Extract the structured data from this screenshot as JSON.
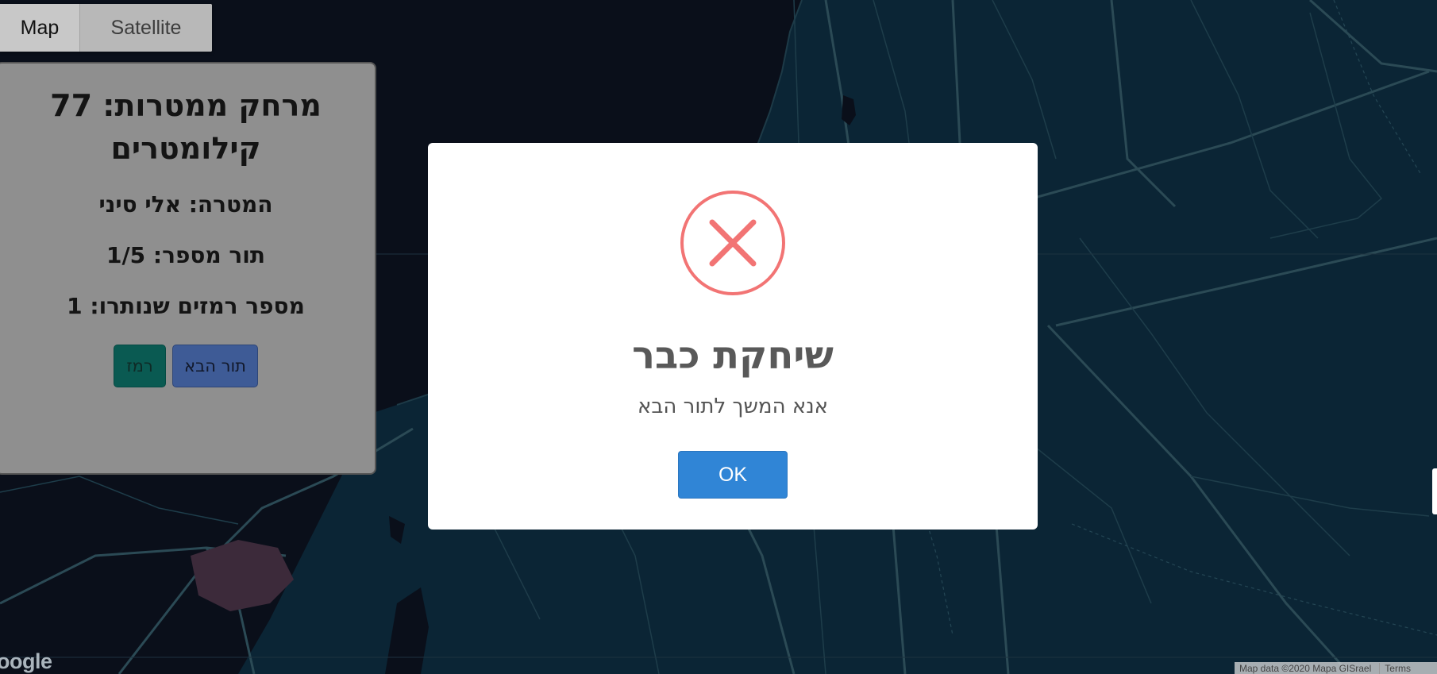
{
  "map": {
    "type_control": {
      "map_label": "Map",
      "satellite_label": "Satellite"
    },
    "google_logo_text": "oogle",
    "attribution": {
      "data_text": "Map data ©2020 Mapa GISrael",
      "terms_text": "Terms"
    },
    "colors": {
      "sea": "#0a0f1a",
      "land": "#0b2535",
      "roads": "#2b4a55",
      "city": "#3c2a3a"
    }
  },
  "info_panel": {
    "distance_title": "מרחק ממטרות: 77 קילומטרים",
    "target_line": "המטרה: אלי סיני",
    "turn_line": "תור מספר: 1/5",
    "hints_line": "מספר רמזים שנותרו: 1",
    "next_turn_button": "תור הבא",
    "hint_button": "רמז"
  },
  "modal": {
    "icon": "error-x-icon",
    "title": "שיחקת כבר",
    "text": "אנא המשך לתור הבא",
    "ok_button": "OK",
    "colors": {
      "icon": "#f27474",
      "button": "#3085d6"
    }
  }
}
